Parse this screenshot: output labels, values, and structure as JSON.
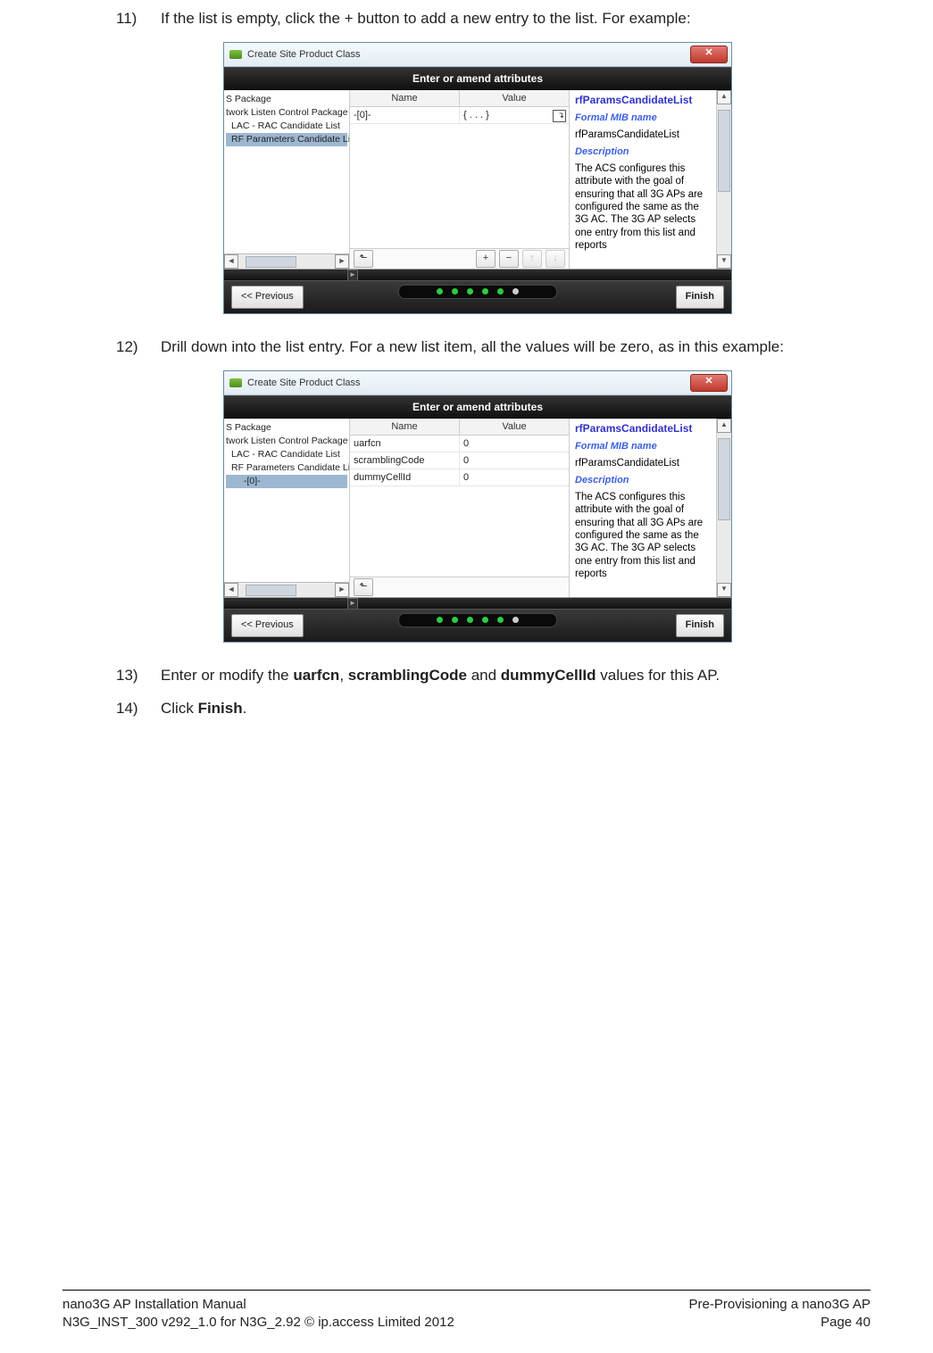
{
  "steps": {
    "s11": {
      "num": "11)",
      "text": "If the list is empty, click the + button to add a new entry to the list. For example:"
    },
    "s12": {
      "num": "12)",
      "text": "Drill down into the list entry. For a new list item, all the values will be zero, as in this example:"
    },
    "s13": {
      "num": "13)",
      "pre": "Enter or modify the ",
      "b1": "uarfcn",
      "mid1": ", ",
      "b2": "scramblingCode",
      "mid2": " and ",
      "b3": "dummyCellId",
      "post": " values for this AP."
    },
    "s14": {
      "num": "14)",
      "pre": "Click ",
      "b1": "Finish",
      "post": "."
    }
  },
  "win": {
    "title": "Create Site Product Class",
    "close": "✕",
    "banner": "Enter or amend attributes",
    "cols": {
      "name": "Name",
      "value": "Value"
    },
    "prev": "<< Previous",
    "finish": "Finish"
  },
  "shot1": {
    "tree": {
      "r0": "S Package",
      "r1": "twork Listen Control Package",
      "r2": "LAC - RAC Candidate List",
      "r3": "RF Parameters Candidate List"
    },
    "row": {
      "name": "-[0]-",
      "value": "{ . . . }"
    },
    "toolbar": {
      "up": "⬑",
      "add": "+",
      "remove": "−",
      "moveup": "↑",
      "movedown": "↓"
    }
  },
  "shot2": {
    "tree": {
      "r0": "S Package",
      "r1": "twork Listen Control Package",
      "r2": "LAC - RAC Candidate List",
      "r3": "RF Parameters Candidate List",
      "r4": "-[0]-"
    },
    "rows": [
      {
        "name": "uarfcn",
        "value": "0"
      },
      {
        "name": "scramblingCode",
        "value": "0"
      },
      {
        "name": "dummyCellId",
        "value": "0"
      }
    ],
    "toolbar": {
      "up": "⬑"
    }
  },
  "info": {
    "title": "rfParamsCandidateList",
    "mibLabel": "Formal MIB name",
    "mibValue": "rfParamsCandidateList",
    "descLabel": "Description",
    "descText": "The ACS configures this attribute with the goal of ensuring that all 3G APs are configured the same as the 3G AC. The 3G AP selects one entry from this list and reports"
  },
  "scroll": {
    "left": "◄",
    "right": "►",
    "up": "▲",
    "down": "▼"
  },
  "footer": {
    "l1": "nano3G AP Installation Manual",
    "l2": "N3G_INST_300 v292_1.0 for N3G_2.92 © ip.access Limited 2012",
    "r1": "Pre-Provisioning a nano3G AP",
    "r2": "Page 40"
  }
}
